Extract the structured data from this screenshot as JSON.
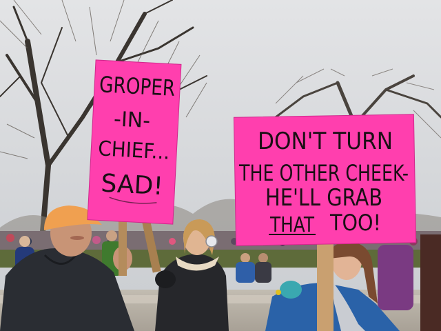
{
  "photo": {
    "sky_color": "#d3d5d8",
    "ground_color": "#b9b3a8",
    "sign_color": "#ff3fae"
  },
  "left_sign": {
    "lines": [
      "GROPER",
      "-IN-",
      "CHIEF...",
      "SAD!"
    ]
  },
  "right_sign": {
    "lines": [
      "DON'T TURN",
      "THE OTHER CHEEK-",
      "HE'LL GRAB",
      "THAT",
      "TOO!"
    ]
  },
  "icons": {
    "left_person_cap": "orange-cap-icon",
    "earmuffs": "earmuffs-icon"
  }
}
